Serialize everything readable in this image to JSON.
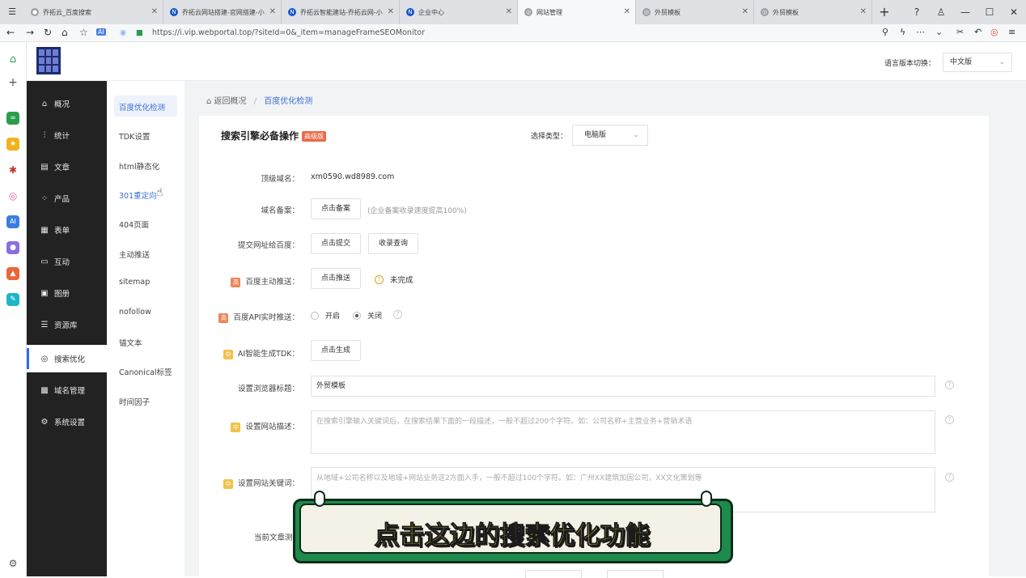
{
  "browser": {
    "tabs": [
      {
        "label": "乔拓云_百度搜索",
        "active": false
      },
      {
        "label": "乔拓云网站搭建-官网搭建-小",
        "active": false
      },
      {
        "label": "乔拓云智能建站-乔拓云网-小",
        "active": false
      },
      {
        "label": "企业中心",
        "active": false
      },
      {
        "label": "网站管理",
        "active": true
      },
      {
        "label": "外贸模板",
        "active": false
      },
      {
        "label": "外贸模板",
        "active": false
      }
    ],
    "new_tab": "+",
    "url": "https://i.vip.webportal.top/?siteId=0&_item=manageFrameSEOMonitor"
  },
  "header": {
    "lang_label": "语言版本切换：",
    "lang_value": "中文版"
  },
  "sidebar": {
    "items": [
      {
        "label": "概况",
        "icon": "home-icon",
        "active": false
      },
      {
        "label": "统计",
        "icon": "chart-icon",
        "active": false
      },
      {
        "label": "文章",
        "icon": "article-icon",
        "active": false
      },
      {
        "label": "产品",
        "icon": "product-icon",
        "active": false
      },
      {
        "label": "表单",
        "icon": "form-icon",
        "active": false
      },
      {
        "label": "互动",
        "icon": "chat-icon",
        "active": false
      },
      {
        "label": "图册",
        "icon": "album-icon",
        "active": false
      },
      {
        "label": "资源库",
        "icon": "database-icon",
        "active": false
      },
      {
        "label": "搜索优化",
        "icon": "search-optimize-icon",
        "active": true
      },
      {
        "label": "域名管理",
        "icon": "domain-icon",
        "active": false
      },
      {
        "label": "系统设置",
        "icon": "gear-icon",
        "active": false
      }
    ]
  },
  "submenu": {
    "items": [
      {
        "label": "百度优化检测",
        "active": true
      },
      {
        "label": "TDK设置",
        "active": false
      },
      {
        "label": "html静态化",
        "active": false
      },
      {
        "label": "301重定向",
        "active": false
      },
      {
        "label": "404页面",
        "active": false
      },
      {
        "label": "主动推送",
        "active": false
      },
      {
        "label": "sitemap",
        "active": false
      },
      {
        "label": "nofollow",
        "active": false
      },
      {
        "label": "锚文本",
        "active": false
      },
      {
        "label": "Canonical标签",
        "active": false
      },
      {
        "label": "时间因子",
        "active": false
      }
    ]
  },
  "breadcrumb": {
    "back": "返回概况",
    "separator": "/",
    "current": "百度优化检测"
  },
  "card": {
    "title": "搜索引擎必备操作",
    "title_tag": "高级版",
    "type_label": "选择类型：",
    "type_value": "电脑版",
    "rows": {
      "domain_label": "顶级域名：",
      "domain_value": "xm0590.wd8989.com",
      "beian_label": "域名备案：",
      "beian_button": "点击备案",
      "beian_hint": "(企业备案收录速度提高100%)",
      "submit_label": "提交网址给百度：",
      "submit_button": "点击提交",
      "query_button": "收录查询",
      "push_label": "百度主动推送：",
      "push_badge": "高",
      "push_button": "点击推送",
      "push_status": "未完成",
      "api_label": "百度API实时推送：",
      "api_badge": "高",
      "api_on": "开启",
      "api_off": "关闭",
      "ai_label": "AI智能生成TDK：",
      "ai_badge": "中",
      "ai_button": "点击生成",
      "title_label": "设置浏览器标题：",
      "title_value": "外贸模板",
      "desc_label": "设置网站描述：",
      "desc_badge": "中",
      "desc_placeholder": "在搜索引擎输入关键词后，在搜索结果下面的一段描述，一般不超过200个字符。如：公司名称+主营业务+营销术语",
      "kw_label": "设置网站关键词：",
      "kw_badge": "中",
      "kw_placeholder": "从地域+公司名称以及地域+网站业务这2方面入手，一般不超过100个字符。如：广州XX建筑加固公司，XX文化策划等",
      "cur_label": "当前文章测"
    }
  },
  "caption": {
    "text": "点击这边的搜索优化功能"
  },
  "colors": {
    "sidebar_bg": "#222222",
    "accent": "#3b6fd6",
    "tag": "#e86b4a",
    "caption_green": "#1e8a4b",
    "caption_text": "#f7d63b"
  }
}
